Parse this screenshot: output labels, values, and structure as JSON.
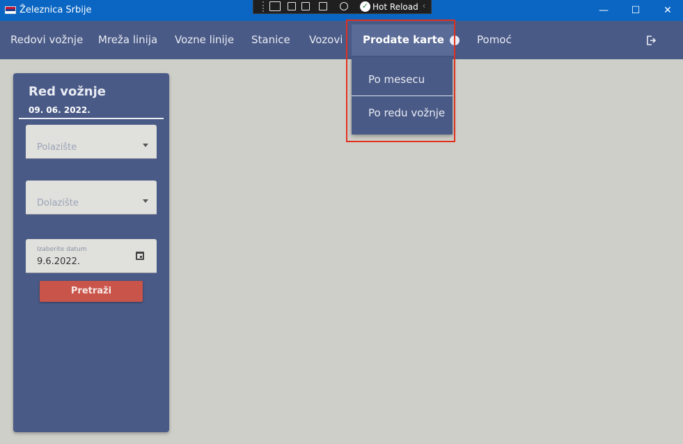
{
  "window": {
    "title": "Železnica Srbije",
    "minimize_label": "—",
    "maximize_label": "☐",
    "close_label": "✕"
  },
  "hot_reload": {
    "label": "Hot Reload",
    "check_glyph": "✓",
    "collapse_glyph": "‹"
  },
  "menu": {
    "items": [
      {
        "label": "Redovi vožnje"
      },
      {
        "label": "Mreža linija"
      },
      {
        "label": "Vozne linije"
      },
      {
        "label": "Stanice"
      },
      {
        "label": "Vozovi"
      },
      {
        "label": "Prodate karte"
      },
      {
        "label": "Pomoć"
      }
    ],
    "info_glyph": "!"
  },
  "dropdown": {
    "items": [
      {
        "label": "Po mesecu"
      },
      {
        "label": "Po redu vožnje"
      }
    ]
  },
  "panel": {
    "title": "Red vožnje",
    "date": "09. 06. 2022.",
    "departure_placeholder": "Polazište",
    "arrival_placeholder": "Dolazište",
    "date_field_label": "Izaberite datum",
    "date_field_value": "9.6.2022.",
    "search_label": "Pretraži"
  },
  "colors": {
    "titlebar": "#0a66c2",
    "menubar": "#4a5a86",
    "menu_active": "#5a6b97",
    "background": "#cfcfca",
    "search_button": "#c9544a",
    "highlight": "#e0301e"
  }
}
